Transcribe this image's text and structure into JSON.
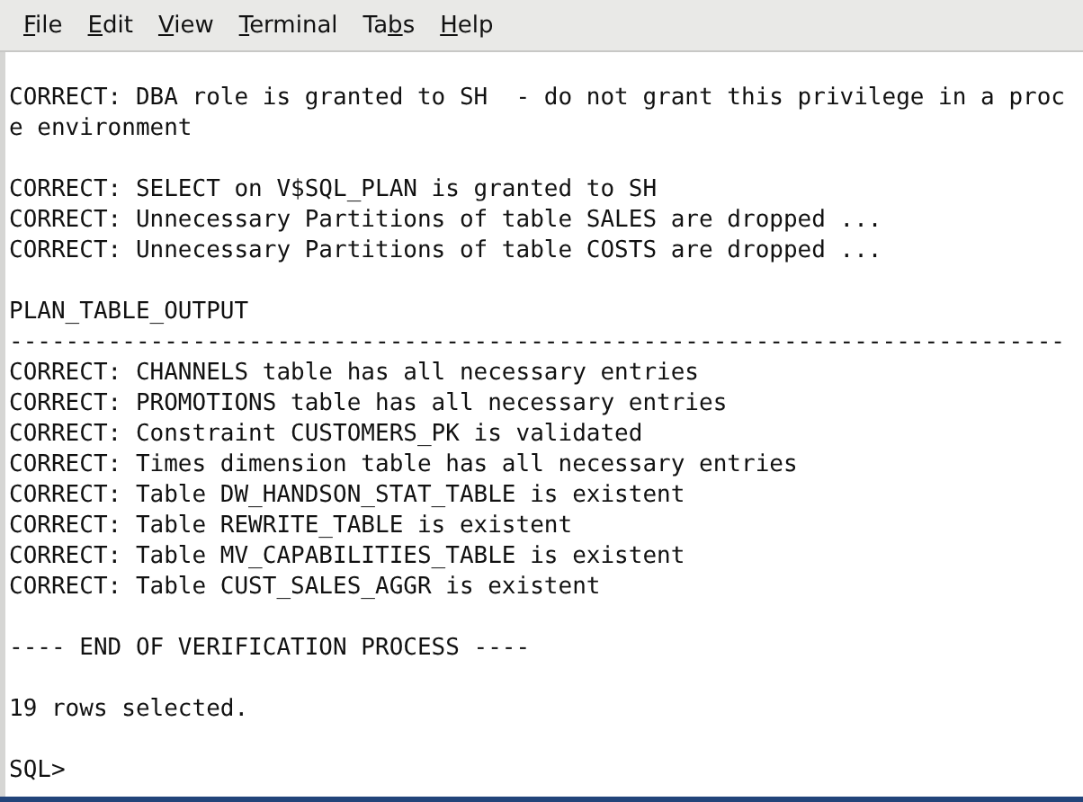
{
  "menu": [
    {
      "key": "F",
      "post": "ile"
    },
    {
      "key": "E",
      "post": "dit"
    },
    {
      "key": "V",
      "post": "iew"
    },
    {
      "key": "T",
      "post": "erminal"
    },
    {
      "pre": "Ta",
      "key": "b",
      "post": "s"
    },
    {
      "key": "H",
      "post": "elp"
    }
  ],
  "terminal": {
    "blocks": [
      {
        "lines": [
          "CORRECT: DBA role is granted to SH  - do not grant this privilege in a proc",
          "e environment"
        ]
      },
      {
        "lines": [
          "CORRECT: SELECT on V$SQL_PLAN is granted to SH",
          "CORRECT: Unnecessary Partitions of table SALES are dropped ...",
          "CORRECT: Unnecessary Partitions of table COSTS are dropped ..."
        ]
      },
      {
        "lines": [
          "PLAN_TABLE_OUTPUT",
          "---------------------------------------------------------------------------",
          "CORRECT: CHANNELS table has all necessary entries",
          "CORRECT: PROMOTIONS table has all necessary entries",
          "CORRECT: Constraint CUSTOMERS_PK is validated",
          "CORRECT: Times dimension table has all necessary entries",
          "CORRECT: Table DW_HANDSON_STAT_TABLE is existent",
          "CORRECT: Table REWRITE_TABLE is existent",
          "CORRECT: Table MV_CAPABILITIES_TABLE is existent",
          "CORRECT: Table CUST_SALES_AGGR is existent"
        ]
      },
      {
        "lines": [
          "---- END OF VERIFICATION PROCESS ----"
        ]
      },
      {
        "lines": [
          "19 rows selected."
        ]
      },
      {
        "lines": [
          "SQL>"
        ]
      }
    ]
  }
}
